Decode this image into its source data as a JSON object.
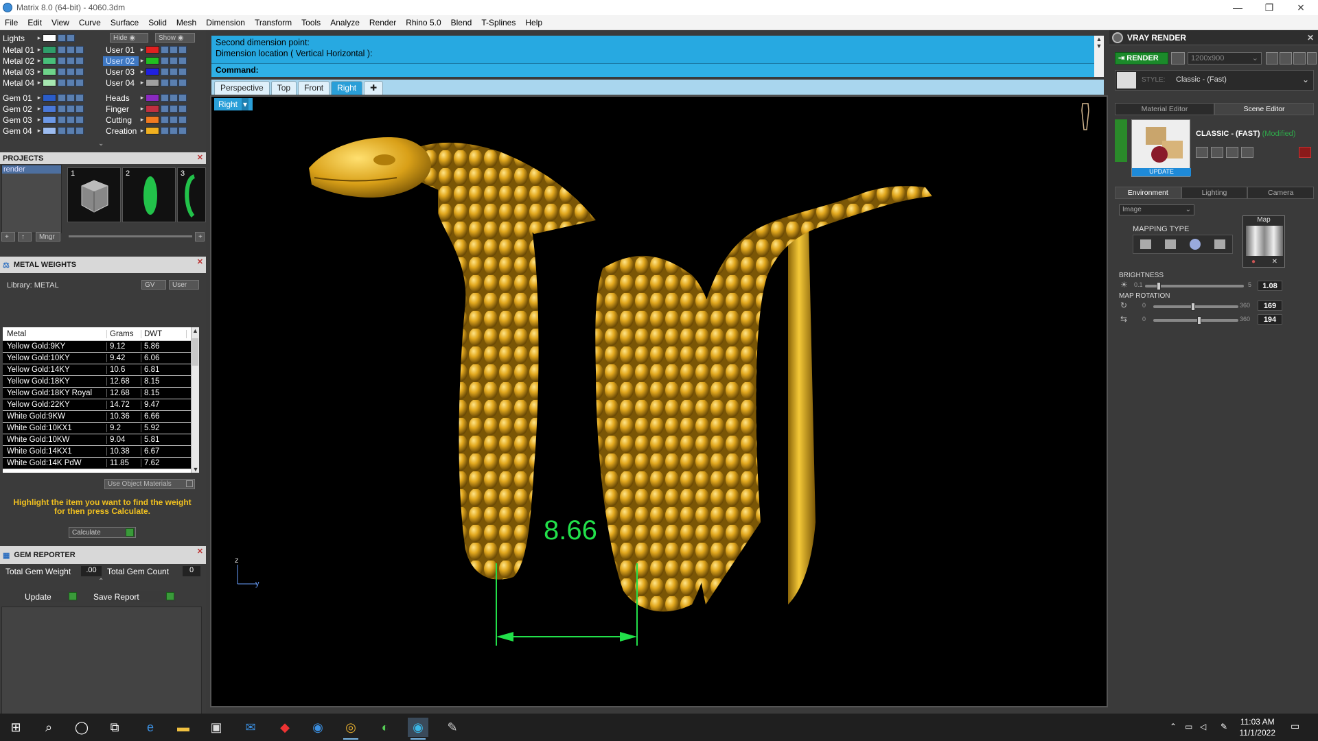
{
  "window": {
    "title": "Matrix 8.0 (64-bit) - 4060.3dm",
    "minimize": "—",
    "maximize": "❐",
    "close": "✕"
  },
  "menu": [
    "File",
    "Edit",
    "View",
    "Curve",
    "Surface",
    "Solid",
    "Mesh",
    "Dimension",
    "Transform",
    "Tools",
    "Analyze",
    "Render",
    "Rhino 5.0",
    "Blend",
    "T-Splines",
    "Help"
  ],
  "layers": {
    "lights_label": "Lights",
    "hide_label": "Hide",
    "show_label": "Show",
    "left": [
      {
        "name": "Metal 01",
        "color": "#2f9e6a"
      },
      {
        "name": "Metal 02",
        "color": "#48c07a"
      },
      {
        "name": "Metal 03",
        "color": "#6ed48a"
      },
      {
        "name": "Metal 04",
        "color": "#a6e6b0"
      },
      {
        "name": "Gem 01",
        "color": "#2a5cc8"
      },
      {
        "name": "Gem 02",
        "color": "#4a78d8"
      },
      {
        "name": "Gem 03",
        "color": "#6c98e6"
      },
      {
        "name": "Gem 04",
        "color": "#9cbcf0"
      }
    ],
    "right": [
      {
        "name": "User 01",
        "color": "#e02020"
      },
      {
        "name": "User 02",
        "color": "#20c020"
      },
      {
        "name": "User 03",
        "color": "#2020e0"
      },
      {
        "name": "User 04",
        "color": "#a0a0a0"
      },
      {
        "name": "Heads",
        "color": "#8a2ac0"
      },
      {
        "name": "Finger",
        "color": "#c03040"
      },
      {
        "name": "Cutting",
        "color": "#f07a20"
      },
      {
        "name": "Creation",
        "color": "#f0b020"
      }
    ]
  },
  "projects": {
    "title": "PROJECTS",
    "items": [
      "render"
    ],
    "thumbs": [
      "1",
      "2",
      "3"
    ],
    "mngr_label": "Mngr"
  },
  "metal_weights": {
    "title": "METAL WEIGHTS",
    "library": "Library: METAL",
    "gv_label": "GV",
    "user_label": "User",
    "columns": [
      "Metal",
      "Grams",
      "DWT"
    ],
    "rows": [
      [
        "Yellow Gold:9KY",
        "9.12",
        "5.86"
      ],
      [
        "Yellow Gold:10KY",
        "9.42",
        "6.06"
      ],
      [
        "Yellow Gold:14KY",
        "10.6",
        "6.81"
      ],
      [
        "Yellow Gold:18KY",
        "12.68",
        "8.15"
      ],
      [
        "Yellow Gold:18KY Royal",
        "12.68",
        "8.15"
      ],
      [
        "Yellow Gold:22KY",
        "14.72",
        "9.47"
      ],
      [
        "White Gold:9KW",
        "10.36",
        "6.66"
      ],
      [
        "White Gold:10KX1",
        "9.2",
        "5.92"
      ],
      [
        "White Gold:10KW",
        "9.04",
        "5.81"
      ],
      [
        "White Gold:14KX1",
        "10.38",
        "6.67"
      ],
      [
        "White Gold:14K PdW",
        "11.85",
        "7.62"
      ]
    ],
    "use_object_materials": "Use Object Materials",
    "hint": "Highlight the item you want to find the weight for then press Calculate.",
    "calculate_label": "Calculate"
  },
  "gem_reporter": {
    "title": "GEM REPORTER",
    "total_weight_label": "Total Gem Weight",
    "total_weight_value": ".00",
    "total_count_label": "Total Gem Count",
    "total_count_value": "0",
    "update_label": "Update",
    "save_report_label": "Save Report"
  },
  "command": {
    "line1": "Second dimension point:",
    "line2": "Dimension location ( Vertical  Horizontal ):",
    "prompt": "Command:"
  },
  "viewport": {
    "tabs": [
      "Perspective",
      "Top",
      "Front",
      "Right"
    ],
    "active_tab": "Right",
    "label": "Right",
    "dimension_value": "8.66",
    "axis_z": "z",
    "axis_y": "y"
  },
  "vray": {
    "title": "VRAY RENDER",
    "render_label": "RENDER",
    "resolution": "1200x900",
    "style_label": "STYLE:",
    "style_value": "Classic - (Fast)",
    "editor_tabs": [
      "Material Editor",
      "Scene Editor"
    ],
    "active_editor_tab": "Scene Editor",
    "preset_name": "CLASSIC - (FAST)",
    "preset_modified": "(Modified)",
    "update_label": "UPDATE",
    "section_tabs": [
      "Environment",
      "Lighting",
      "Camera"
    ],
    "active_section_tab": "Environment",
    "image_dropdown": "Image",
    "mapping_type_label": "MAPPING TYPE",
    "map_label": "Map",
    "brightness_label": "BRIGHTNESS",
    "brightness_min": "0.1",
    "brightness_max": "5",
    "brightness_value": "1.08",
    "brightness_level": 0.14,
    "map_rotation_label": "MAP ROTATION",
    "rotation_min": "0",
    "rotation_max": "360",
    "rotation1_value": "169",
    "rotation1_level": 0.47,
    "rotation2_value": "194",
    "rotation2_level": 0.54
  },
  "taskbar": {
    "time": "11:03 AM",
    "date": "11/1/2022"
  },
  "colors": {
    "accent": "#27a9e1",
    "gold": "#d9a520",
    "dimension_green": "#22e04a"
  }
}
